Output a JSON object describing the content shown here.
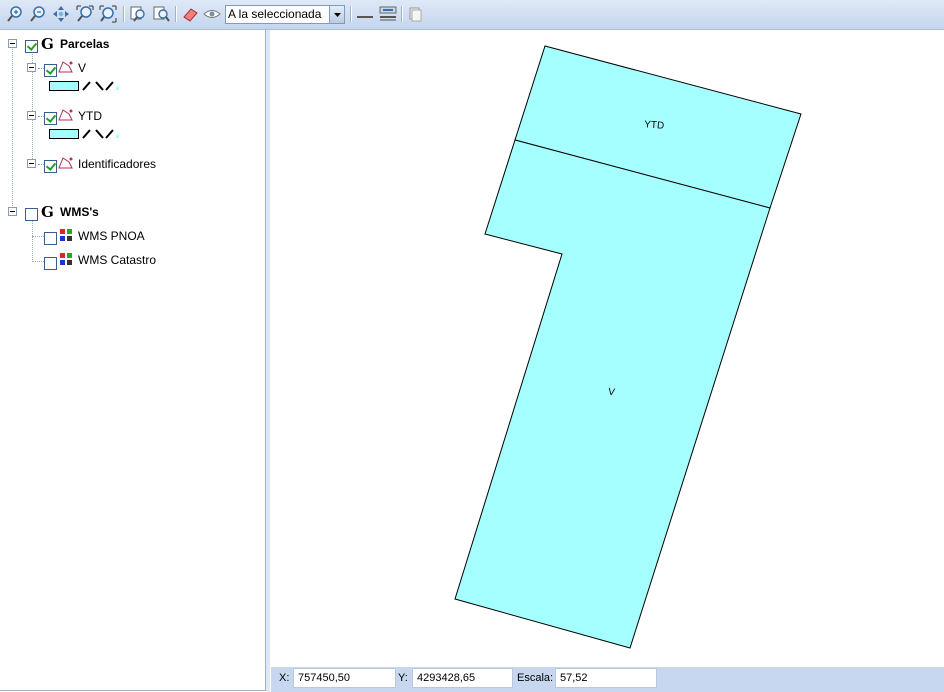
{
  "toolbar": {
    "scale_select_value": "A la seleccionada",
    "buttons": [
      "zoom-in-icon",
      "zoom-out-icon",
      "pan-icon",
      "zoom-extent-icon",
      "zoom-full-icon",
      "zoom-previous-icon",
      "zoom-next-icon",
      "eraser-icon",
      "eye-icon",
      "line-icon",
      "layout-icon",
      "copy-icon"
    ]
  },
  "tree": {
    "groups": [
      {
        "label": "G",
        "name": "Parcelas",
        "checked": true,
        "layers": [
          {
            "name": "V",
            "checked": true
          },
          {
            "name": "YTD",
            "checked": true
          },
          {
            "name": "Identificadores",
            "checked": true
          }
        ]
      },
      {
        "label": "G",
        "name": "WMS's",
        "checked": false,
        "layers": [
          {
            "name": "WMS PNOA",
            "checked": false
          },
          {
            "name": "WMS Catastro",
            "checked": false
          }
        ]
      }
    ]
  },
  "map": {
    "fill_color": "#a6ffff",
    "parcel_labels": {
      "ytd": "YTD",
      "v": "V"
    }
  },
  "status": {
    "x_label": "X:",
    "x_value": "757450,50",
    "y_label": "Y:",
    "y_value": "4293428,65",
    "scale_label": "Escala:",
    "scale_value": "57,52"
  }
}
